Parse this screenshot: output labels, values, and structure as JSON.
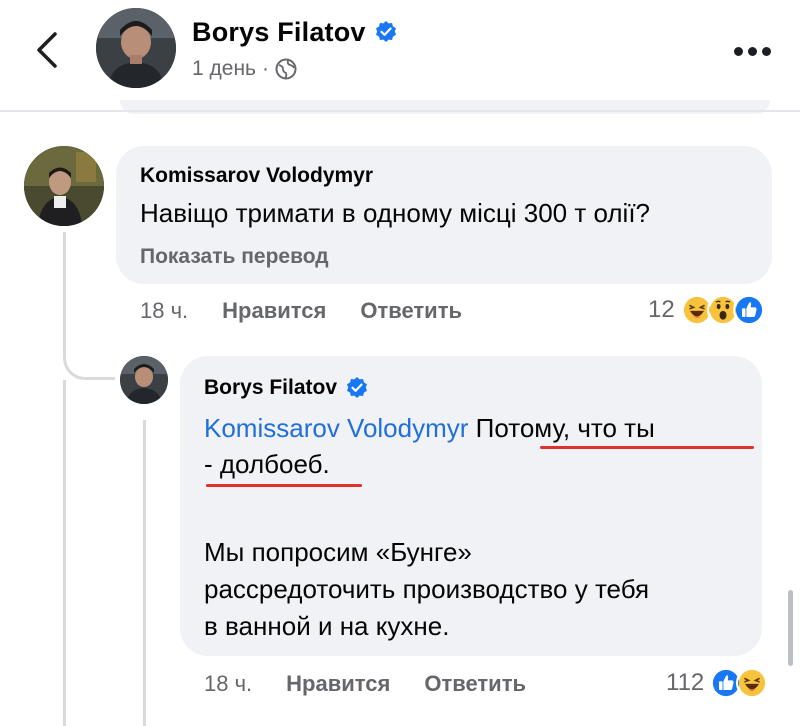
{
  "header": {
    "author_name": "Borys Filatov",
    "time": "1 день",
    "separator": "·",
    "back_icon": "chevron-left-icon",
    "more_icon": "more-horizontal-icon",
    "audience_icon": "globe-icon"
  },
  "comments": [
    {
      "author": "Komissarov Volodymyr",
      "text": "Навіщо тримати в одному місці 300 т олії?",
      "translate_label": "Показать перевод",
      "time": "18 ч.",
      "like_label": "Нравится",
      "reply_label": "Ответить",
      "reaction_count": "12",
      "reactions": [
        "haha",
        "wow",
        "like"
      ]
    },
    {
      "author": "Borys Filatov",
      "mention": "Komissarov Volodymyr",
      "text_part1": "Потому, что ты",
      "text_part2": "- долбоеб.",
      "paragraph2_line1": "Мы попросим «Бунге»",
      "paragraph2_line2": "рассредоточить производство у тебя",
      "paragraph2_line3": "в ванной и на кухне.",
      "time": "18 ч.",
      "like_label": "Нравится",
      "reply_label": "Ответить",
      "reaction_count": "112",
      "reactions": [
        "like",
        "haha"
      ]
    }
  ],
  "colors": {
    "accent_blue": "#1877f2",
    "mention_blue": "#216fdb",
    "secondary_text": "#65676b",
    "bubble_bg": "#f0f2f5",
    "highlight_red": "#e0312b"
  }
}
